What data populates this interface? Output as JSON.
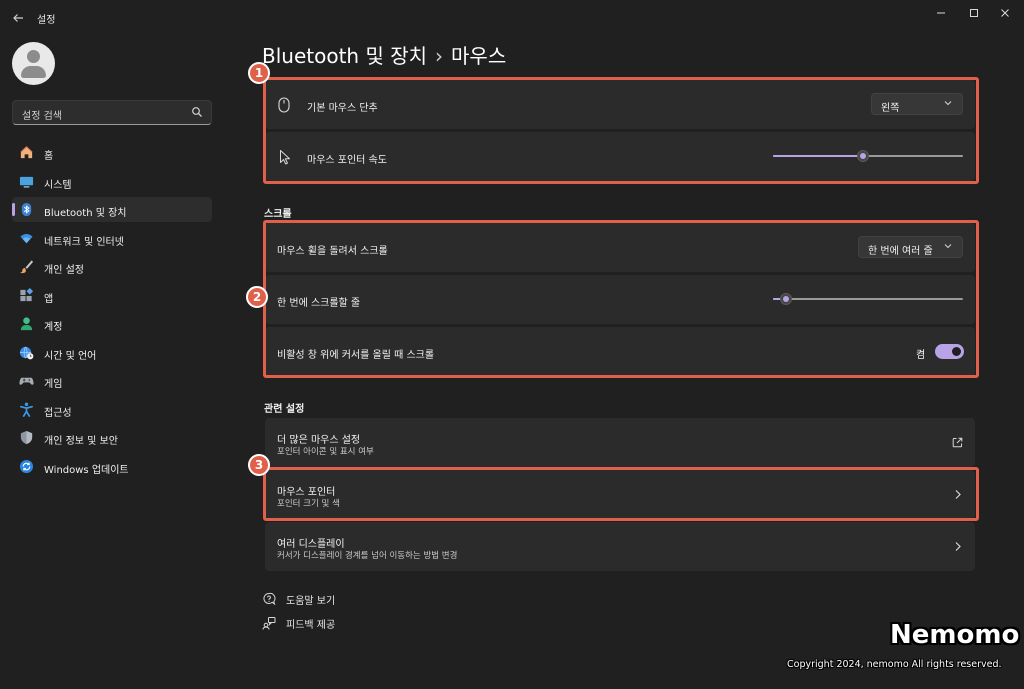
{
  "window": {
    "title": "설정",
    "back_icon": "arrow-left-icon",
    "controls": [
      "minimize-icon",
      "maximize-icon",
      "close-icon"
    ]
  },
  "sidebar": {
    "search_placeholder": "설정 검색",
    "items": [
      {
        "label": "홈",
        "icon": "home-icon",
        "active": false
      },
      {
        "label": "시스템",
        "icon": "monitor-icon",
        "active": false
      },
      {
        "label": "Bluetooth 및 장치",
        "icon": "bluetooth-icon",
        "active": true
      },
      {
        "label": "네트워크 및 인터넷",
        "icon": "wifi-icon",
        "active": false
      },
      {
        "label": "개인 설정",
        "icon": "brush-icon",
        "active": false
      },
      {
        "label": "앱",
        "icon": "apps-icon",
        "active": false
      },
      {
        "label": "계정",
        "icon": "account-icon",
        "active": false
      },
      {
        "label": "시간 및 언어",
        "icon": "globe-clock-icon",
        "active": false
      },
      {
        "label": "게임",
        "icon": "gamepad-icon",
        "active": false
      },
      {
        "label": "접근성",
        "icon": "accessibility-icon",
        "active": false
      },
      {
        "label": "개인 정보 및 보안",
        "icon": "shield-icon",
        "active": false
      },
      {
        "label": "Windows 업데이트",
        "icon": "update-icon",
        "active": false
      }
    ]
  },
  "header": {
    "breadcrumb_parent": "Bluetooth 및 장치",
    "breadcrumb_sep": "›",
    "breadcrumb_current": "마우스"
  },
  "group1": {
    "primary_button_label": "기본 마우스 단추",
    "primary_button_value": "왼쪽",
    "pointer_speed_label": "마우스 포인터 속도",
    "pointer_speed_level": 0.47
  },
  "scroll": {
    "section_title": "스크롤",
    "wheel_label": "마우스 휠을 돌려서 스크롤",
    "wheel_value": "한 번에 여러 줄",
    "lines_label": "한 번에 스크롤할 줄",
    "lines_level": 0.04,
    "inactive_label": "비활성 창 위에 커서를 올릴 때 스크롤",
    "inactive_state": "켬"
  },
  "related": {
    "section_title": "관련 설정",
    "items": [
      {
        "title": "더 많은 마우스 설정",
        "subtitle": "포인터 아이콘 및 표시 여부",
        "icon": "external-link-icon"
      },
      {
        "title": "마우스 포인터",
        "subtitle": "포인터 크기 및 색",
        "icon": "chevron-right-icon"
      },
      {
        "title": "여러 디스플레이",
        "subtitle": "커서가 디스플레이 경계를 넘어 이동하는 방법 변경",
        "icon": "chevron-right-icon"
      }
    ]
  },
  "footer_links": {
    "help": "도움말 보기",
    "feedback": "피드백 제공"
  },
  "annotations": {
    "badge1": "1",
    "badge2": "2",
    "badge3": "3",
    "color": "#e0604a"
  },
  "watermark": {
    "title": "Nemomo",
    "copyright": "Copyright 2024, nemomo All rights reserved."
  },
  "colors": {
    "accent": "#b7a3e6",
    "background": "#202020",
    "card": "#2b2b2b"
  }
}
